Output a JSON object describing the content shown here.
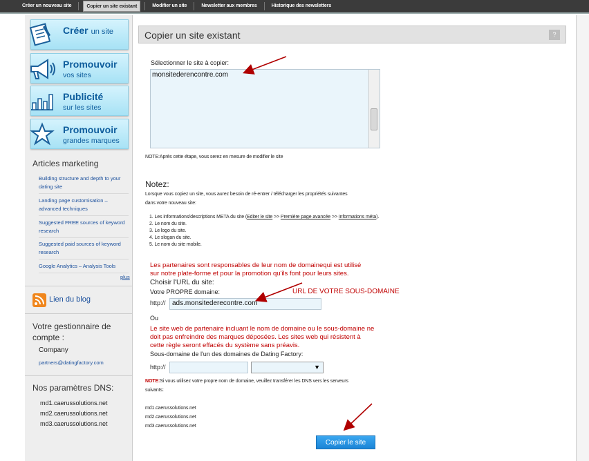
{
  "top_tabs": [
    "Créer un nouveau site",
    "Copier un site existant",
    "Modifier un site",
    "Newsletter aux membres",
    "Historique des newsletters"
  ],
  "sidebar": {
    "buttons": [
      {
        "title": "Créer",
        "title_suffix": "un site",
        "subtitle": "",
        "icon": "document-icon"
      },
      {
        "title": "Promouvoir",
        "title_suffix": "",
        "subtitle": "vos sites",
        "icon": "megaphone-icon"
      },
      {
        "title": "Publicité",
        "title_suffix": "",
        "subtitle": "sur les sites",
        "icon": "chart-icon"
      },
      {
        "title": "Promouvoir",
        "title_suffix": "",
        "subtitle": "grandes marques",
        "icon": "star-icon"
      }
    ],
    "articles_heading": "Articles marketing",
    "articles": [
      "Building structure and depth to your dating site",
      "Landing page customisation – advanced techniques",
      "Suggested FREE sources of keyword research",
      "Suggested paid sources of keyword research",
      "Google Analytics – Analysis Tools"
    ],
    "plus": "plus",
    "blog_link": "Lien du blog",
    "manager_heading": "Votre gestionnaire de compte :",
    "manager_name": "Company",
    "manager_email": "partners@datingfactory.com",
    "dns_heading": "Nos paramètres DNS:",
    "dns": [
      "md1.caerussolutions.net",
      "md2.caerussolutions.net",
      "md3.caerussolutions.net"
    ]
  },
  "main": {
    "title": "Copier un site existant",
    "help": "?",
    "select_label": "Sélectionner le site à copier:",
    "selected_site": "monsitederencontre.com",
    "note_after": "NOTE:Après cette étape, vous serez en mesure de modifier le site",
    "notez_heading": "Notez:",
    "notez_text_1": "Lorsque vous copiez un site, vous aurez besoin de ré-entrer / télécharger les propriétés suivantes",
    "notez_text_2": "dans votre nouveau site:",
    "list": {
      "item1_prefix": "1. Les informations/descriptions META du site (",
      "link1": "Editer le site",
      "sep": " >> ",
      "link2": "Première page avancée",
      "link3": "Informations méta",
      "item1_suffix": ").",
      "item2": "2. Le nom du site.",
      "item3": "3. Le logo du site.",
      "item4": "4. Le slogan du site.",
      "item5": "5. Le nom du site mobile."
    },
    "warning1_line1": "Les partenaires sont responsables de leur nom de domainequi est utilisé",
    "warning1_line2": "sur notre plate-forme et pour la promotion qu'ils font pour leurs sites.",
    "choose_url": "Choisir l'URL du site:",
    "own_domain_label": "Votre PROPRE domaine:",
    "http_prefix": "http://",
    "domain_value": "ads.monsitederecontre.com",
    "subdomain_annotation": "URL DE VOTRE SOUS-DOMAINE",
    "ou": "Ou",
    "warning2_line1": "Le site web de partenaire incluant le nom de domaine ou le sous-domaine ne",
    "warning2_line2": "doit pas enfreindre des marques déposées. Les sites web qui résistent à",
    "warning2_line3": "cette règle seront effacés du système sans préavis.",
    "subdomain_label": "Sous-domaine de l'un des domaines de Dating Factory:",
    "select_arrow": "▼",
    "dns_note_prefix": "NOTE:",
    "dns_note_line1": "Si vous utilisez votre propre nom de domaine, veuillez transférer les DNS vers les serveurs",
    "dns_note_line2": "suivants:",
    "dns": [
      "md1.caerussolutions.net",
      "md2.caerussolutions.net",
      "md3.caerussolutions.net"
    ],
    "copy_button": "Copier le site"
  },
  "colors": {
    "accent": "#1b84d6",
    "warning": "#c00000",
    "link": "#1a4f9c",
    "arrow": "#b00000"
  }
}
